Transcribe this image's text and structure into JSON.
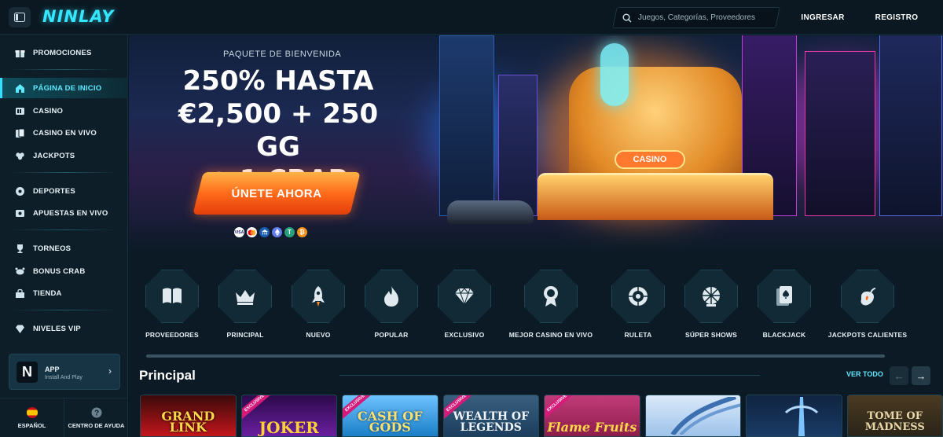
{
  "header": {
    "logo": "NINLAY",
    "search_placeholder": "Juegos, Categorías, Proveedores",
    "login_label": "INGRESAR",
    "register_label": "REGISTRO"
  },
  "sidebar": {
    "items": [
      {
        "label": "PROMOCIONES",
        "icon": "gift-icon"
      },
      {
        "label": "PÁGINA DE INICIO",
        "icon": "home-icon",
        "active": true
      },
      {
        "label": "CASINO",
        "icon": "slot-icon"
      },
      {
        "label": "CASINO EN VIVO",
        "icon": "cards-icon"
      },
      {
        "label": "JACKPOTS",
        "icon": "clover-icon"
      },
      {
        "label": "DEPORTES",
        "icon": "ball-icon"
      },
      {
        "label": "APUESTAS EN VIVO",
        "icon": "live-icon"
      },
      {
        "label": "TORNEOS",
        "icon": "trophy-icon"
      },
      {
        "label": "BONUS CRAB",
        "icon": "crab-icon"
      },
      {
        "label": "TIENDA",
        "icon": "shop-icon"
      },
      {
        "label": "NIVELES VIP",
        "icon": "diamond-icon"
      }
    ],
    "app": {
      "logo": "N",
      "title": "APP",
      "subtitle": "Install And Play"
    },
    "footer": {
      "language": "ESPAÑOL",
      "help": "CENTRO DE AYUDA"
    }
  },
  "banner": {
    "subtitle": "PAQUETE DE BIENVENIDA",
    "headline_1": "250% HASTA",
    "headline_2": "€2,500 + 250 GG",
    "headline_3": "+ 1 CRAB",
    "cta_label": "ÚNETE AHORA",
    "sign_text": "CASINO",
    "payments": [
      "VISA",
      "MC",
      "BANK",
      "ETH",
      "USDT",
      "BTC"
    ]
  },
  "categories": [
    {
      "label": "PROVEEDORES",
      "icon": "book-icon"
    },
    {
      "label": "PRINCIPAL",
      "icon": "crown-icon"
    },
    {
      "label": "NUEVO",
      "icon": "rocket-icon"
    },
    {
      "label": "POPULAR",
      "icon": "flame-icon"
    },
    {
      "label": "EXCLUSIVO",
      "icon": "gem-icon"
    },
    {
      "label": "MEJOR CASINO EN VIVO",
      "icon": "medal-icon"
    },
    {
      "label": "RULETA",
      "icon": "roulette-icon"
    },
    {
      "label": "SÚPER SHOWS",
      "icon": "wheel-icon"
    },
    {
      "label": "BLACKJACK",
      "icon": "spade-card-icon"
    },
    {
      "label": "JACKPOTS CALIENTES",
      "icon": "hot-pepper-icon"
    }
  ],
  "section": {
    "title": "Principal",
    "see_all": "VER TODO"
  },
  "games": [
    {
      "title": "GRAND LINK",
      "exclusive": false,
      "color": "#c4161c"
    },
    {
      "title": "JOKER",
      "exclusive": true,
      "exclusive_label": "EXCLUSIVE",
      "color": "#6a1fa0"
    },
    {
      "title": "CASH OF GODS",
      "exclusive": true,
      "exclusive_label": "EXCLUSIVE",
      "color": "#1a7fc7"
    },
    {
      "title": "WEALTH OF LEGENDS",
      "exclusive": true,
      "exclusive_label": "EXCLUSIVE",
      "color": "#1b3e5e"
    },
    {
      "title": "Flame Fruits",
      "exclusive": true,
      "exclusive_label": "EXCLUSIVE",
      "color": "#8c1d4a"
    },
    {
      "title": "",
      "exclusive": false,
      "color": "#9ec3ea"
    },
    {
      "title": "",
      "exclusive": false,
      "color": "#3a2c1c"
    },
    {
      "title": "TOME OF MADNESS",
      "exclusive": false,
      "color": "#2a2418"
    }
  ]
}
